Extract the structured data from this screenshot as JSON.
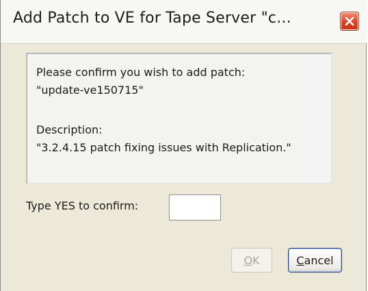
{
  "window": {
    "title": "Add Patch to VE for Tape Server \"c...",
    "close_icon": "close-icon"
  },
  "message": {
    "line1": "Please confirm you wish to add patch:",
    "line2": "\"update-ve150715\"",
    "line3": "Description:",
    "line4": "\"3.2.4.15 patch fixing issues with Replication.\""
  },
  "confirm": {
    "label": "Type YES to confirm:",
    "value": ""
  },
  "buttons": {
    "ok": {
      "mnemonic": "O",
      "rest": "K",
      "enabled": false
    },
    "cancel": {
      "mnemonic": "C",
      "rest": "ancel",
      "enabled": true
    }
  },
  "colors": {
    "window_bg": "#ece9d8",
    "close_red": "#d8431f",
    "focus_border": "#2b3f7a"
  }
}
